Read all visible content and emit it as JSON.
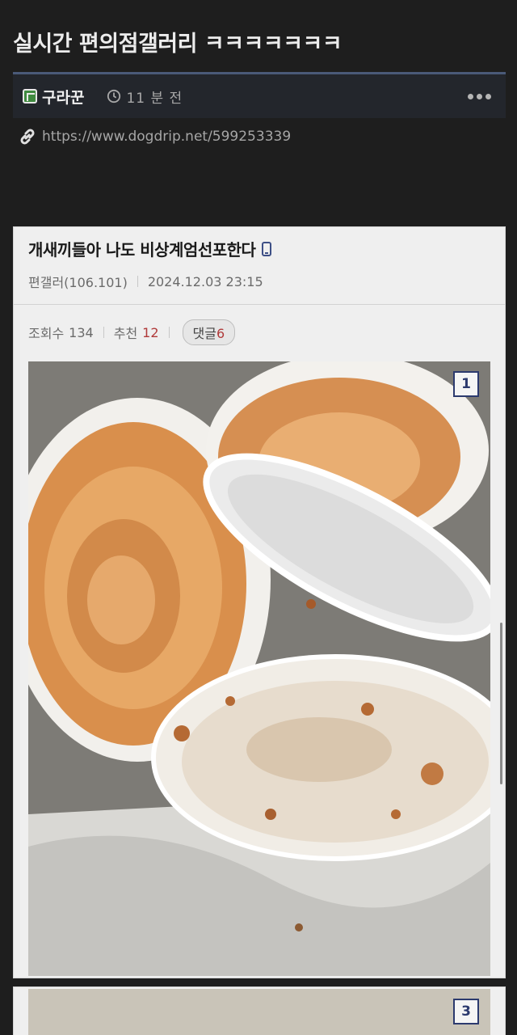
{
  "post": {
    "title": "실시간 편의점갤러리 ㅋㅋㅋㅋㅋㅋㅋ",
    "author": "구라꾼",
    "time": "11 분 전",
    "link": "https://www.dogdrip.net/599253339"
  },
  "embedded": {
    "title": "개새끼들아 나도 비상계엄선포한다",
    "writer": "편갤러(106.101)",
    "datetime": "2024.12.03 23:15",
    "views_label": "조회수",
    "views": "134",
    "recommend_label": "추천",
    "recommend": "12",
    "comments_label": "댓글",
    "comments": "6",
    "image_badge_1": "1",
    "image_badge_2": "3"
  },
  "icons": {
    "author": "site-logo-icon",
    "time": "clock-icon",
    "more": "more-dots-icon",
    "link": "link-icon",
    "device": "mobile-phone-icon"
  },
  "colors": {
    "accent_rule": "#4a5a78",
    "count_red": "#b03a3a",
    "badge_navy": "#2c3a6e"
  }
}
